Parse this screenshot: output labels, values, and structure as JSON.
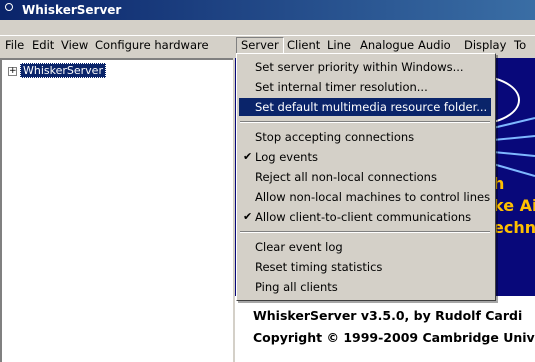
{
  "window": {
    "title": "WhiskerServer"
  },
  "menubar": {
    "items": [
      "File",
      "Edit",
      "View",
      "Configure hardware",
      "Server",
      "Client",
      "Line",
      "Analogue",
      "Audio",
      "Display",
      "To"
    ]
  },
  "tree": {
    "root_label": "WhiskerServer",
    "expander": "+"
  },
  "server_menu": {
    "items": [
      {
        "label": "Set server priority within Windows...",
        "checked": false
      },
      {
        "label": "Set internal timer resolution...",
        "checked": false
      },
      {
        "label": "Set default multimedia resource folder...",
        "checked": false,
        "highlighted": true
      },
      {
        "label": "Stop accepting connections",
        "checked": false
      },
      {
        "label": "Log events",
        "checked": true
      },
      {
        "label": "Reject all non-local connections",
        "checked": false
      },
      {
        "label": "Allow non-local machines to control lines",
        "checked": false
      },
      {
        "label": "Allow client-to-client communications",
        "checked": true
      },
      {
        "label": "Clear event log",
        "checked": false
      },
      {
        "label": "Reset timing statistics",
        "checked": false
      },
      {
        "label": "Ping all clients",
        "checked": false
      }
    ],
    "check_glyph": "✔"
  },
  "about": {
    "graphic_lines": [
      "h",
      "ke Ai",
      "echni"
    ],
    "version_line": "WhiskerServer v3.5.0, by Rudolf Cardi",
    "copyright_line": "Copyright © 1999-2009 Cambridge Univ"
  },
  "colors": {
    "title_active": "#0a246a",
    "highlight": "#0a246a",
    "graphic_bg": "#08087a",
    "graphic_text": "#ffc000"
  }
}
